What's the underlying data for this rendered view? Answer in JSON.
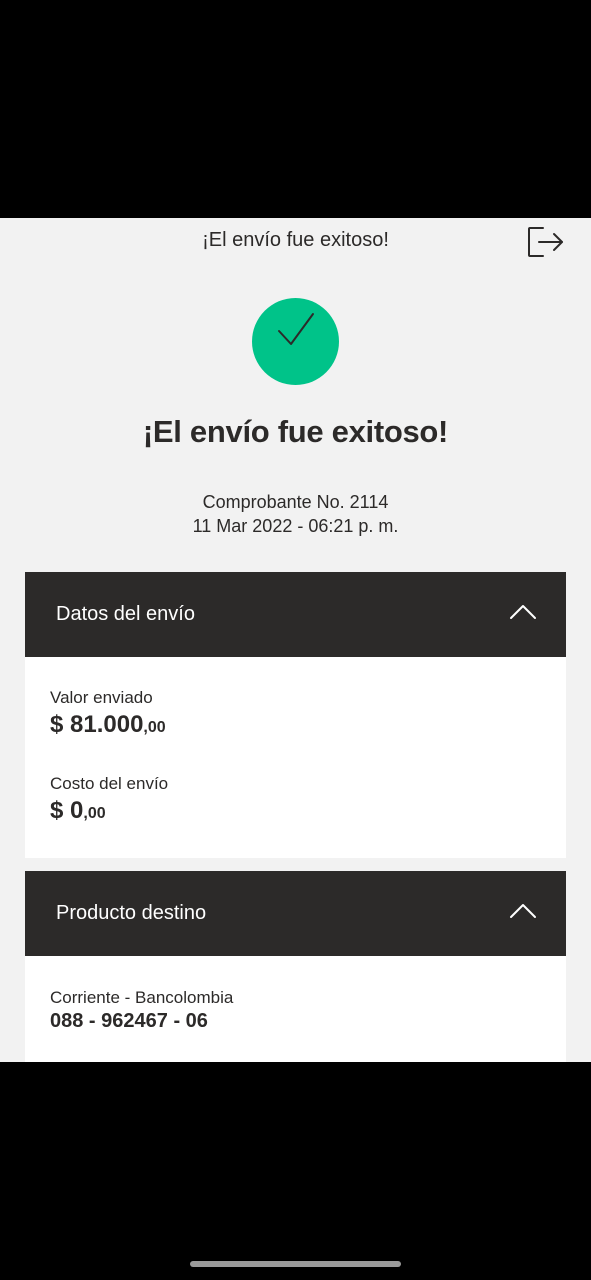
{
  "header": {
    "title": "¡El envío fue exitoso!",
    "exit_icon": "logout-icon"
  },
  "status": {
    "icon": "check-circle-icon",
    "color": "#00c389",
    "title": "¡El envío fue exitoso!",
    "receipt": "Comprobante No. 2114",
    "datetime": "11 Mar 2022 - 06:21 p. m."
  },
  "shipment_section": {
    "title": "Datos del envío",
    "sent_label": "Valor enviado",
    "sent_amount": "$ 81.000",
    "sent_cents": ",00",
    "cost_label": "Costo del envío",
    "cost_amount": "$ 0",
    "cost_cents": ",00"
  },
  "destination_section": {
    "title": "Producto destino",
    "account_type": "Corriente - Bancolombia",
    "account_number": "088 - 962467 - 06"
  },
  "colors": {
    "header_bg": "#2c2a29",
    "screen_bg": "#f2f2f2",
    "accent": "#00c389"
  }
}
